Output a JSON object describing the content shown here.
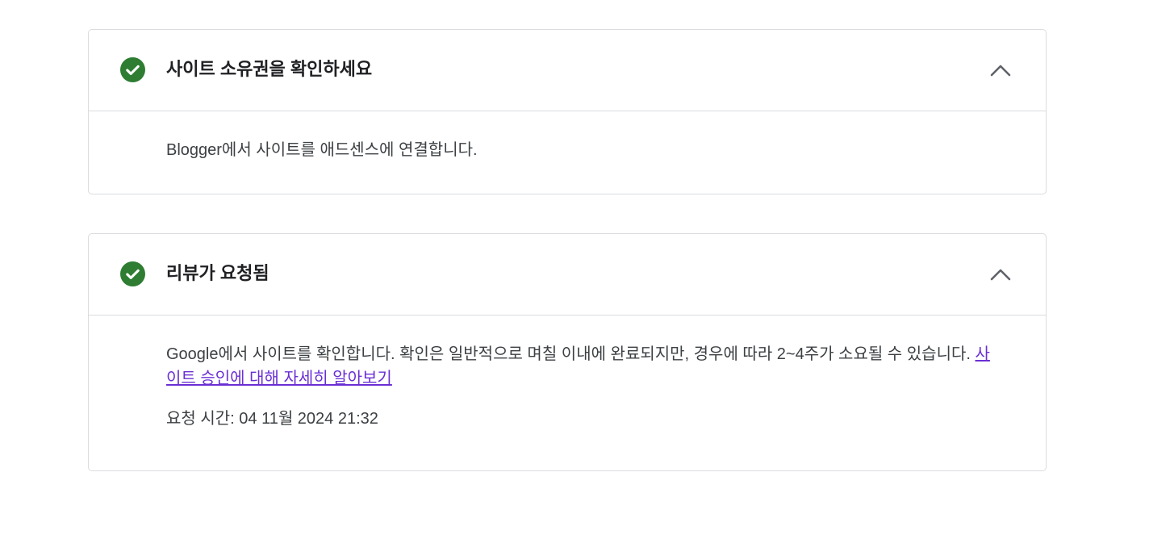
{
  "cards": [
    {
      "title": "사이트 소유권을 확인하세요",
      "status_icon": "check-circle-icon",
      "status_color": "#2e7d32",
      "collapse_icon": "chevron-up-icon",
      "body": "Blogger에서 사이트를 애드센스에 연결합니다."
    },
    {
      "title": "리뷰가 요청됨",
      "status_icon": "check-circle-icon",
      "status_color": "#2e7d32",
      "collapse_icon": "chevron-up-icon",
      "body": "Google에서 사이트를 확인합니다. 확인은 일반적으로 며칠 이내에 완료되지만, 경우에 따라 2~4주가 소요될 수 있습니다.",
      "link_text": "사이트 승인에 대해 자세히 알아보기",
      "requested_label": "요청 시간:",
      "requested_time": "04 11월 2024 21:32"
    }
  ],
  "colors": {
    "link": "#6a2fd4",
    "border": "#dadce0",
    "check": "#2e7d32"
  }
}
